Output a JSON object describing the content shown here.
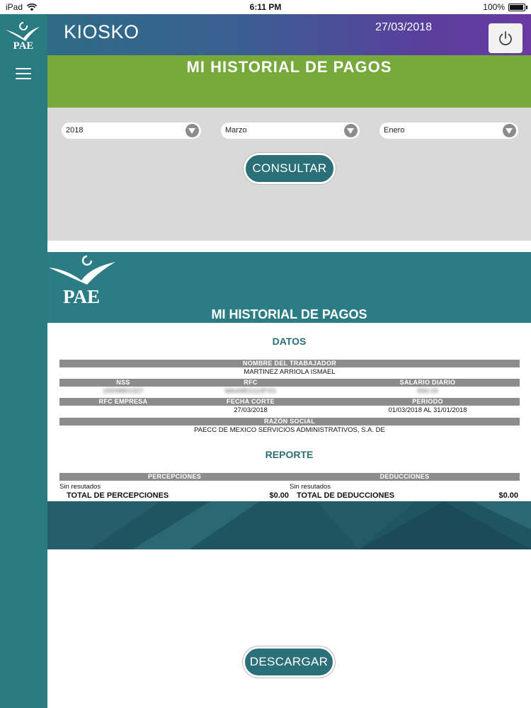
{
  "status_bar": {
    "device": "iPad",
    "time": "6:11 PM",
    "battery": "100%",
    "battery_level": 1.0
  },
  "header": {
    "app_title": "KIOSKO",
    "date": "27/03/2018",
    "logo_text": "PAE"
  },
  "page_title": "MI HISTORIAL DE PAGOS",
  "filters": {
    "year": "2018",
    "month_start": "Marzo",
    "month_end": "Enero",
    "consult_label": "CONSULTAR"
  },
  "report": {
    "logo_text": "PAE",
    "title": "MI HISTORIAL DE PAGOS",
    "datos_title": "DATOS",
    "labels": {
      "nombre": "NOMBRE DEL TRABAJADOR",
      "nss": "NSS",
      "rfc": "RFC",
      "salario": "SALARIO DIARIO",
      "rfc_empresa": "RFC EMPRESA",
      "fecha_corte": "FECHA CORTE",
      "periodo": "PERIODO",
      "razon_social": "RAZÓN SOCIAL"
    },
    "values": {
      "nombre": "MARTINEZ ARRIOLA ISMAEL",
      "nss": "15008801927",
      "rfc": "MAAI801110FXS",
      "salario": "834.04",
      "fecha_corte": "27/03/2018",
      "periodo": "01/03/2018 AL 31/01/2018",
      "razon_social": "PAECC DE MEXICO SERVICIOS ADMINISTRATIVOS, S.A. DE"
    },
    "reporte_title": "REPORTE",
    "percepciones_label": "PERCEPCIONES",
    "deducciones_label": "DEDUCCIONES",
    "percepciones_empty": "Sin resutados",
    "deducciones_empty": "Sin resutados",
    "total_percepciones_label": "TOTAL DE PERCEPCIONES",
    "total_percepciones": "$0.00",
    "total_deducciones_label": "TOTAL DE DEDUCCIONES",
    "total_deducciones": "$0.00"
  },
  "download_label": "DESCARGAR",
  "colors": {
    "teal": "#2a7a82",
    "button": "#2b7078",
    "green": "#77a83a",
    "purple": "#6a3aa2",
    "gray_row": "#8c8c8c",
    "panel": "#d9d9d9"
  }
}
